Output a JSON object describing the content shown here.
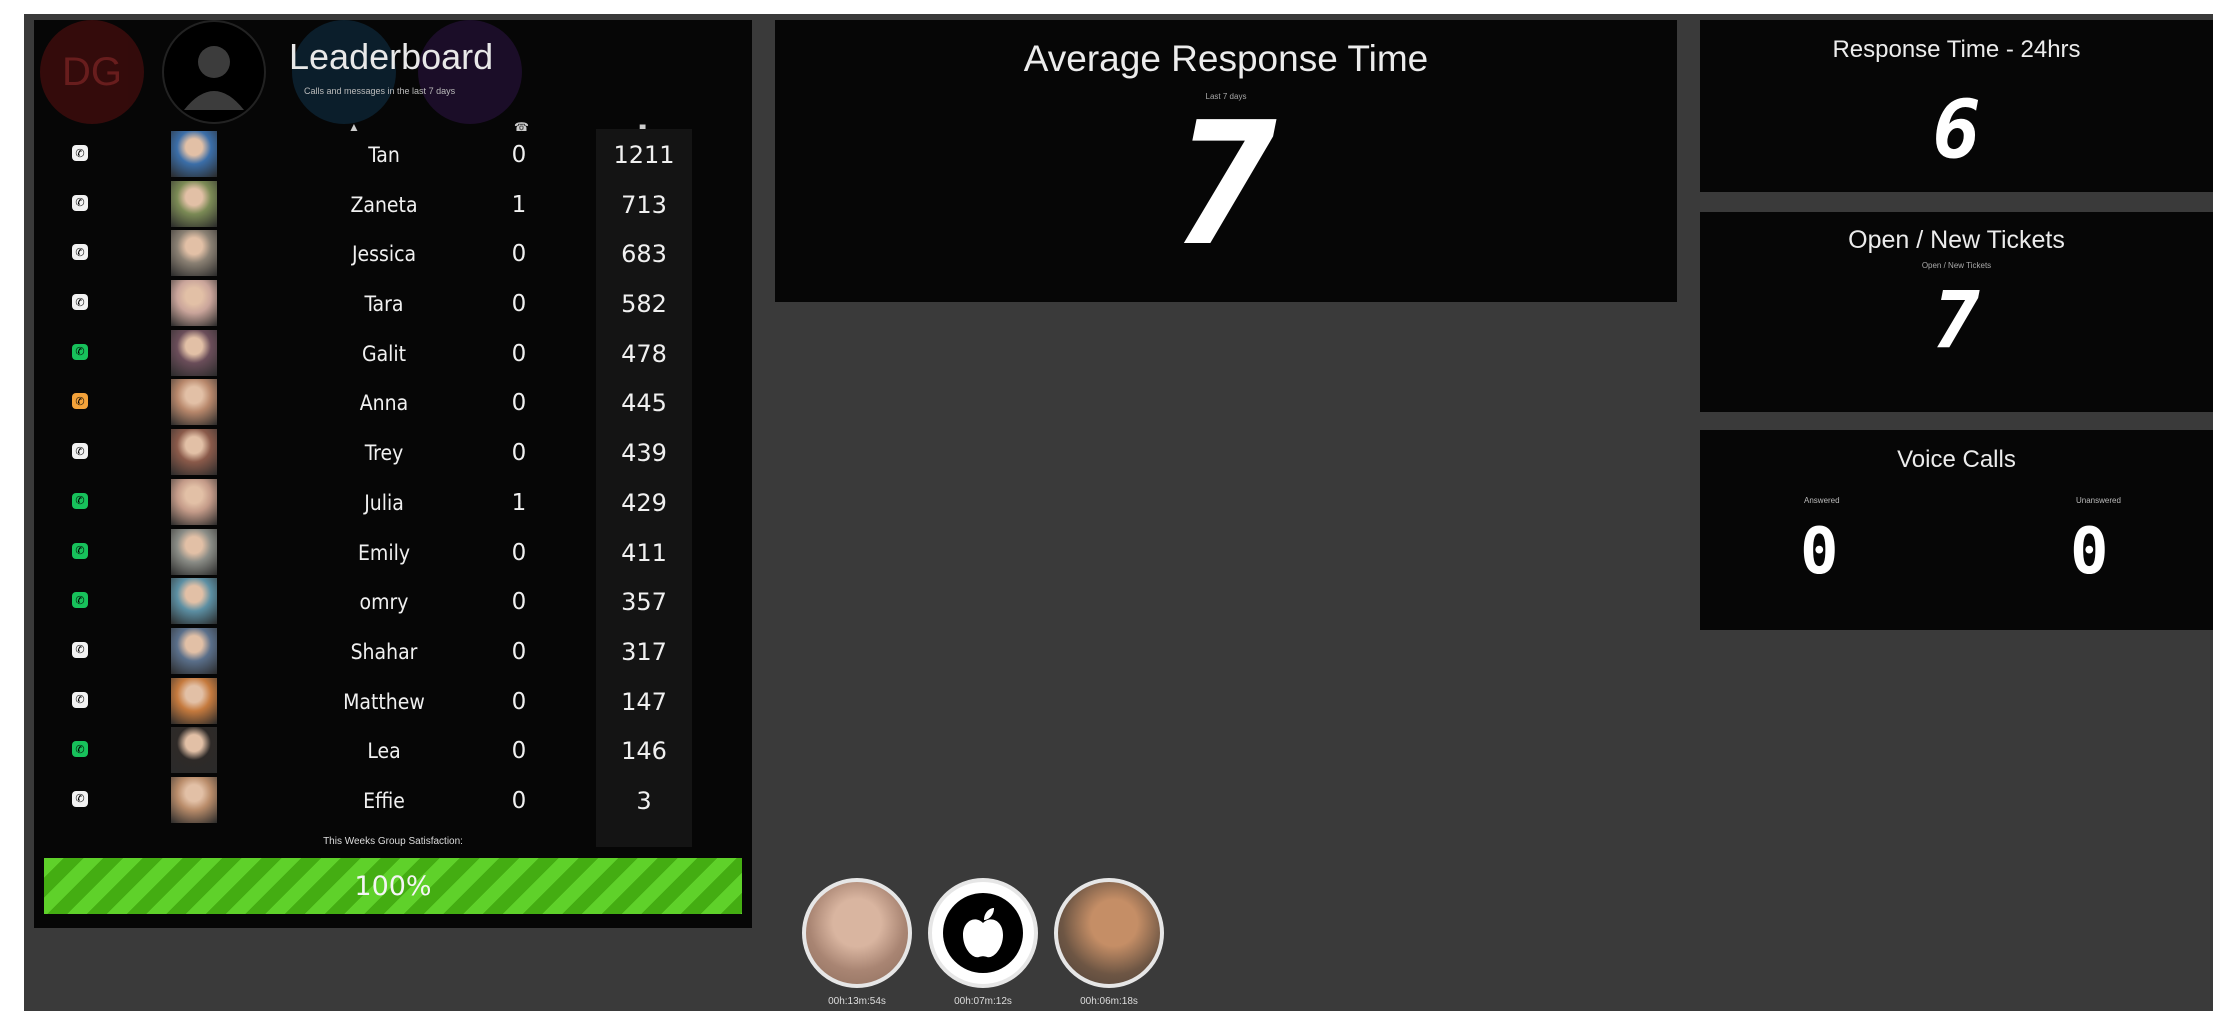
{
  "leaderboard": {
    "title": "Leaderboard",
    "subtitle": "Calls and messages in the last 7 days",
    "initials": "DG",
    "col_icons": {
      "rank": "▲",
      "calls": "☎",
      "messages": "■"
    },
    "rows": [
      {
        "name": "Tan",
        "calls": "0",
        "messages": "1211",
        "status": "white"
      },
      {
        "name": "Zaneta",
        "calls": "1",
        "messages": "713",
        "status": "white"
      },
      {
        "name": "Jessica",
        "calls": "0",
        "messages": "683",
        "status": "white"
      },
      {
        "name": "Tara",
        "calls": "0",
        "messages": "582",
        "status": "white"
      },
      {
        "name": "Galit",
        "calls": "0",
        "messages": "478",
        "status": "green"
      },
      {
        "name": "Anna",
        "calls": "0",
        "messages": "445",
        "status": "orange"
      },
      {
        "name": "Trey",
        "calls": "0",
        "messages": "439",
        "status": "white"
      },
      {
        "name": "Julia",
        "calls": "1",
        "messages": "429",
        "status": "green"
      },
      {
        "name": "Emily",
        "calls": "0",
        "messages": "411",
        "status": "green"
      },
      {
        "name": "omry",
        "calls": "0",
        "messages": "357",
        "status": "green"
      },
      {
        "name": "Shahar",
        "calls": "0",
        "messages": "317",
        "status": "white"
      },
      {
        "name": "Matthew",
        "calls": "0",
        "messages": "147",
        "status": "white"
      },
      {
        "name": "Lea",
        "calls": "0",
        "messages": "146",
        "status": "green"
      },
      {
        "name": "Effie",
        "calls": "0",
        "messages": "3",
        "status": "white"
      }
    ],
    "satisfaction_label": "This Weeks Group Satisfaction:",
    "satisfaction_value": "100%",
    "satisfaction_fraction": 1.0
  },
  "avg_response": {
    "title": "Average Response Time",
    "subtitle": "Last 7 days",
    "value": "7"
  },
  "response_24h": {
    "title": "Response Time - 24hrs",
    "value": "6"
  },
  "tickets": {
    "title": "Open / New Tickets",
    "subtitle": "Open / New Tickets",
    "value": "7"
  },
  "voice_calls": {
    "title": "Voice Calls",
    "answered_label": "Answered",
    "answered_value": "0",
    "unanswered_label": "Unanswered",
    "unanswered_value": "0"
  },
  "agents": [
    {
      "time": "00h:13m:54s",
      "icon": "avatar-photo"
    },
    {
      "time": "00h:07m:12s",
      "icon": "apple-logo-icon"
    },
    {
      "time": "00h:06m:18s",
      "icon": "avatar-photo"
    }
  ],
  "colors": {
    "status_white": "#f2f2f2",
    "status_green": "#17c15b",
    "status_orange": "#f3a23a",
    "bar_green": "#5fd12a"
  }
}
